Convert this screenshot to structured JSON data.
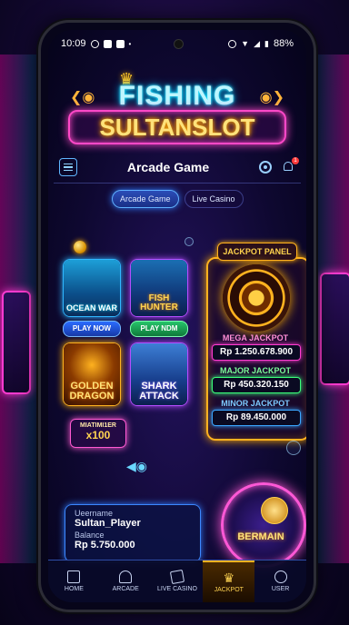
{
  "status_bar": {
    "time": "10:09",
    "battery": "88%"
  },
  "logo": {
    "line1": "FISHING",
    "line2": "SULTANSLOT"
  },
  "header": {
    "title": "Arcade Game",
    "notification_count": "1"
  },
  "tabs": [
    {
      "label": "Arcade Game",
      "active": true
    },
    {
      "label": "Live Casino",
      "active": false
    }
  ],
  "games": [
    {
      "title": "OCEAN WAR",
      "button": "PLAY NOW"
    },
    {
      "title": "FISH HUNTER",
      "button": "PLAY NDM"
    },
    {
      "title": "GOLDEN DRAGON"
    },
    {
      "title": "SHARK ATTACK"
    }
  ],
  "multiplier": {
    "label": "MIATIMI1ER",
    "value": "x100"
  },
  "jackpot": {
    "title": "JACKPOT PANEL",
    "mega_label": "MEGA JACKPOT",
    "mega_value": "Rp 1.250.678.900",
    "major_label": "MAJOR JACKPOT",
    "major_value": "Rp 450.320.150",
    "minor_label": "MINOR JACKPOT",
    "minor_value": "Rp 89.450.000"
  },
  "user": {
    "username_label": "Ueername",
    "username": "Sultan_Player",
    "balance_label": "Balance",
    "balance": "Rp 5.750.000"
  },
  "play_button": "BERMAIN",
  "nav": [
    {
      "label": "HOME",
      "icon": "home-icon"
    },
    {
      "label": "ARCADE",
      "icon": "arcade-icon"
    },
    {
      "label": "LIVE CASINO",
      "icon": "cards-icon"
    },
    {
      "label": "JACKPOT",
      "icon": "crown-icon",
      "active": true
    },
    {
      "label": "USER",
      "icon": "user-icon"
    }
  ],
  "colors": {
    "neon_pink": "#ff48c8",
    "neon_blue": "#00b7ff",
    "gold": "#ffb21f",
    "background": "#160a38"
  }
}
